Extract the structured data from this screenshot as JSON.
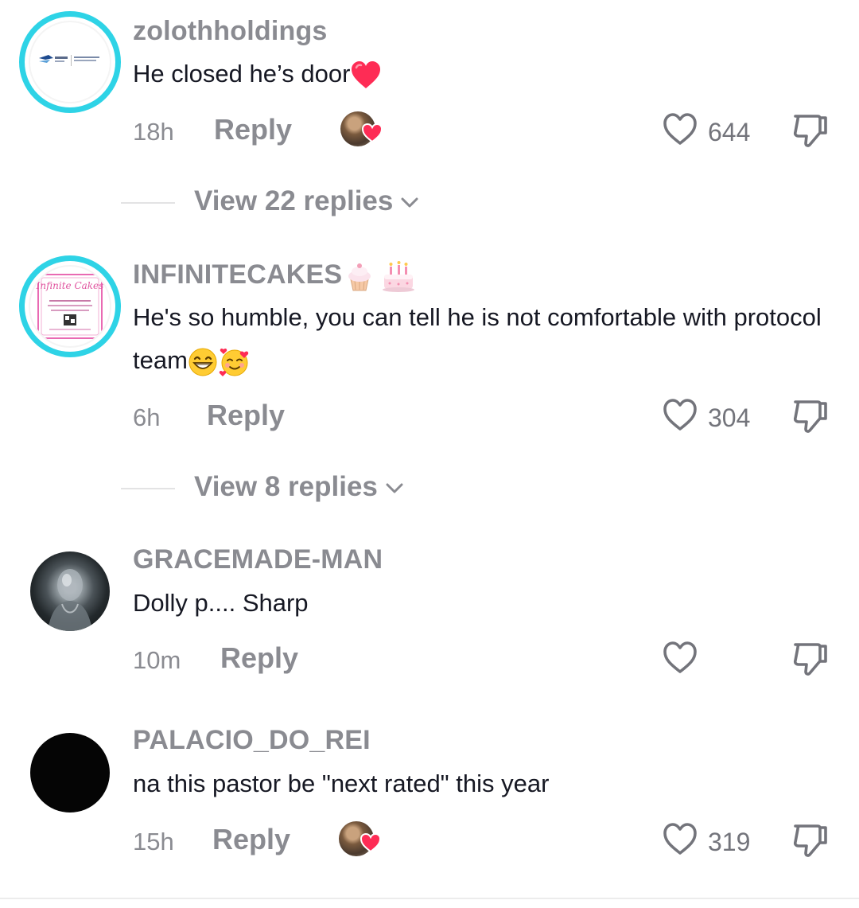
{
  "comments": [
    {
      "username": "zolothholdings",
      "text": "He closed he’s door",
      "time": "18h",
      "reply_label": "Reply",
      "likes": "644",
      "view_replies": "View 22 replies"
    },
    {
      "username": "INFINITECAKES",
      "text": "He's so humble, you can tell he is not comfortable with protocol team",
      "time": "6h",
      "reply_label": "Reply",
      "likes": "304",
      "view_replies": "View 8 replies",
      "avatar_text": "Infinite Cakes"
    },
    {
      "username": "GRACEMADE-MAN",
      "text": "Dolly p.... Sharp",
      "time": "10m",
      "reply_label": "Reply",
      "likes": ""
    },
    {
      "username": "PALACIO_DO_REI",
      "text": "na this pastor be \"next rated\" this year",
      "time": "15h",
      "reply_label": "Reply",
      "likes": "319"
    }
  ],
  "colors": {
    "ring": "#2ed3e6",
    "muted": "#8a8b91",
    "text": "#161823",
    "heart_red": "#fe2c55"
  },
  "icons": [
    "heart-outline-icon",
    "dislike-icon",
    "chevron-down-icon",
    "red-heart-emoji",
    "cupcake-emoji",
    "birthday-cake-emoji",
    "grinning-emoji",
    "smiling-hearts-emoji"
  ]
}
